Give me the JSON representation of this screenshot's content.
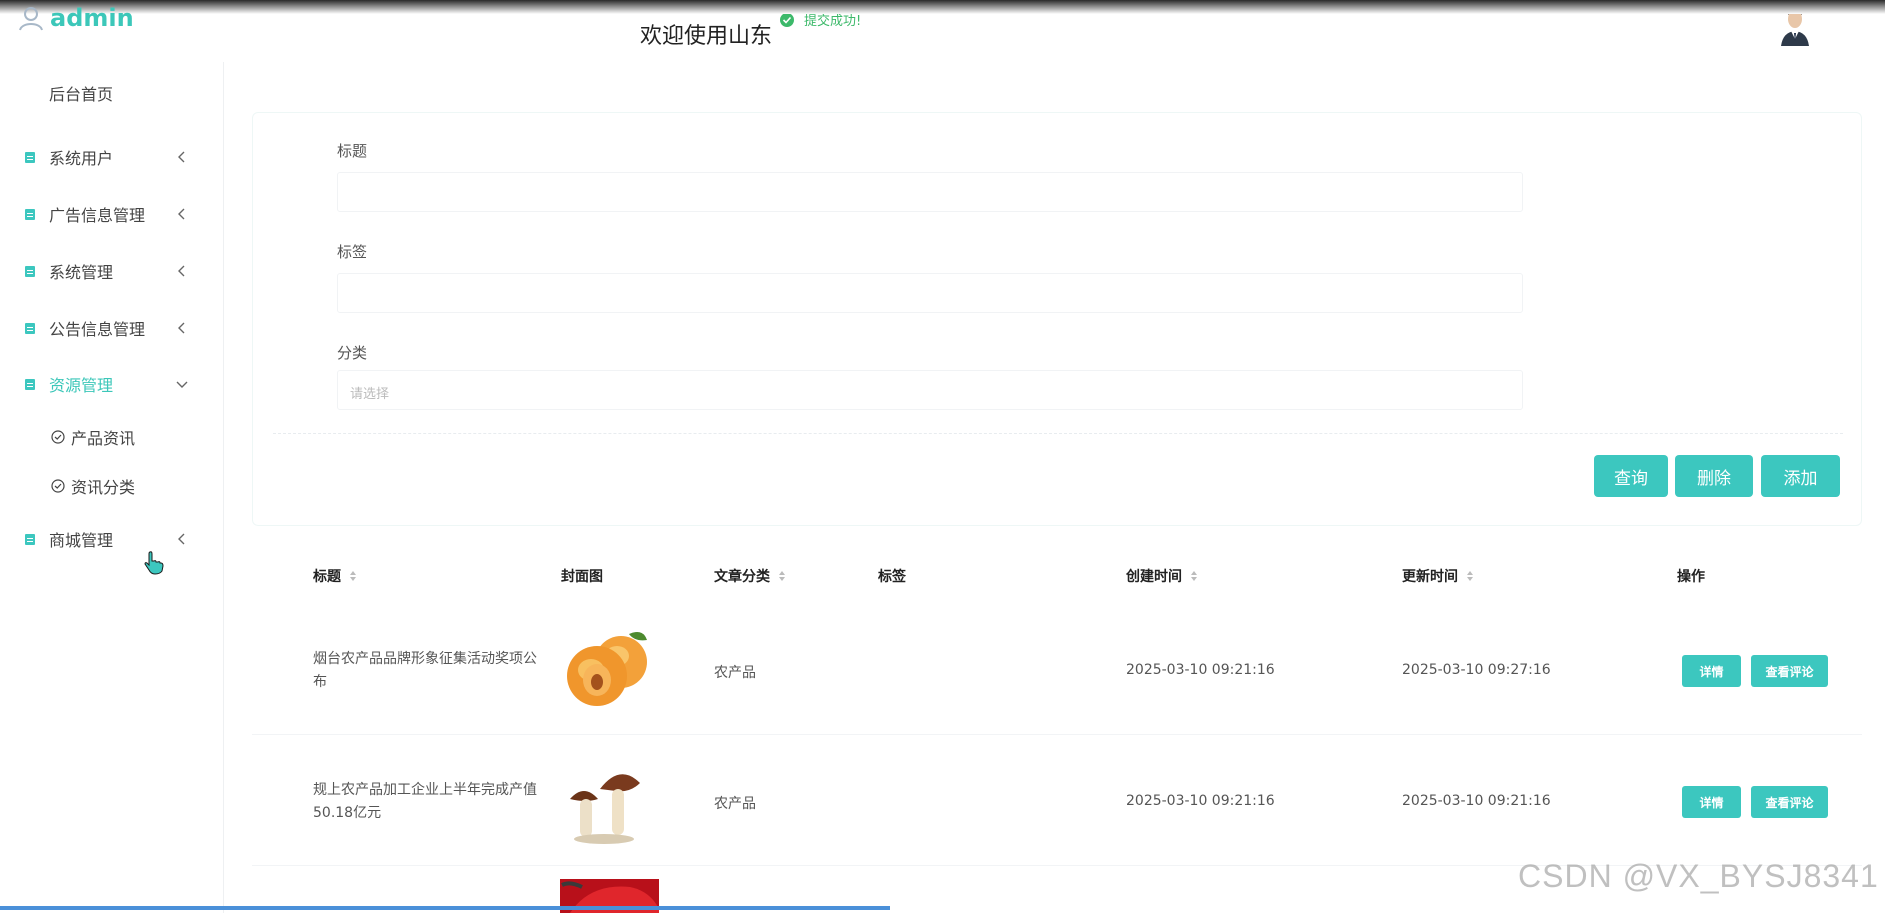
{
  "header": {
    "logo_text": "admin",
    "welcome": "欢迎使用山东",
    "toast": "提交成功!"
  },
  "sidebar": {
    "items": [
      {
        "label": "后台首页"
      },
      {
        "label": "系统用户"
      },
      {
        "label": "广告信息管理"
      },
      {
        "label": "系统管理"
      },
      {
        "label": "公告信息管理"
      },
      {
        "label": "资源管理"
      },
      {
        "label": "商城管理"
      }
    ],
    "sub_items": [
      {
        "label": "产品资讯"
      },
      {
        "label": "资讯分类"
      }
    ]
  },
  "search": {
    "title_label": "标题",
    "title_value": "",
    "tag_label": "标签",
    "tag_value": "",
    "category_label": "分类",
    "category_placeholder": "请选择",
    "query_btn": "查询",
    "delete_btn": "删除",
    "add_btn": "添加"
  },
  "table": {
    "columns": [
      "标题",
      "封面图",
      "文章分类",
      "标签",
      "创建时间",
      "更新时间",
      "操作"
    ],
    "rows": [
      {
        "title": "烟台农产品品牌形象征集活动奖项公布",
        "category": "农产品",
        "tag": "",
        "created": "2025-03-10 09:21:16",
        "updated": "2025-03-10 09:27:16",
        "detail_btn": "详情",
        "comment_btn": "查看评论"
      },
      {
        "title": "规上农产品加工企业上半年完成产值50.18亿元",
        "category": "农产品",
        "tag": "",
        "created": "2025-03-10 09:21:16",
        "updated": "2025-03-10 09:21:16",
        "detail_btn": "详情",
        "comment_btn": "查看评论"
      }
    ]
  },
  "watermark": "CSDN @VX_BYSJ8341",
  "colors": {
    "accent": "#3cc7bf",
    "toast_green": "#3cb96a"
  }
}
